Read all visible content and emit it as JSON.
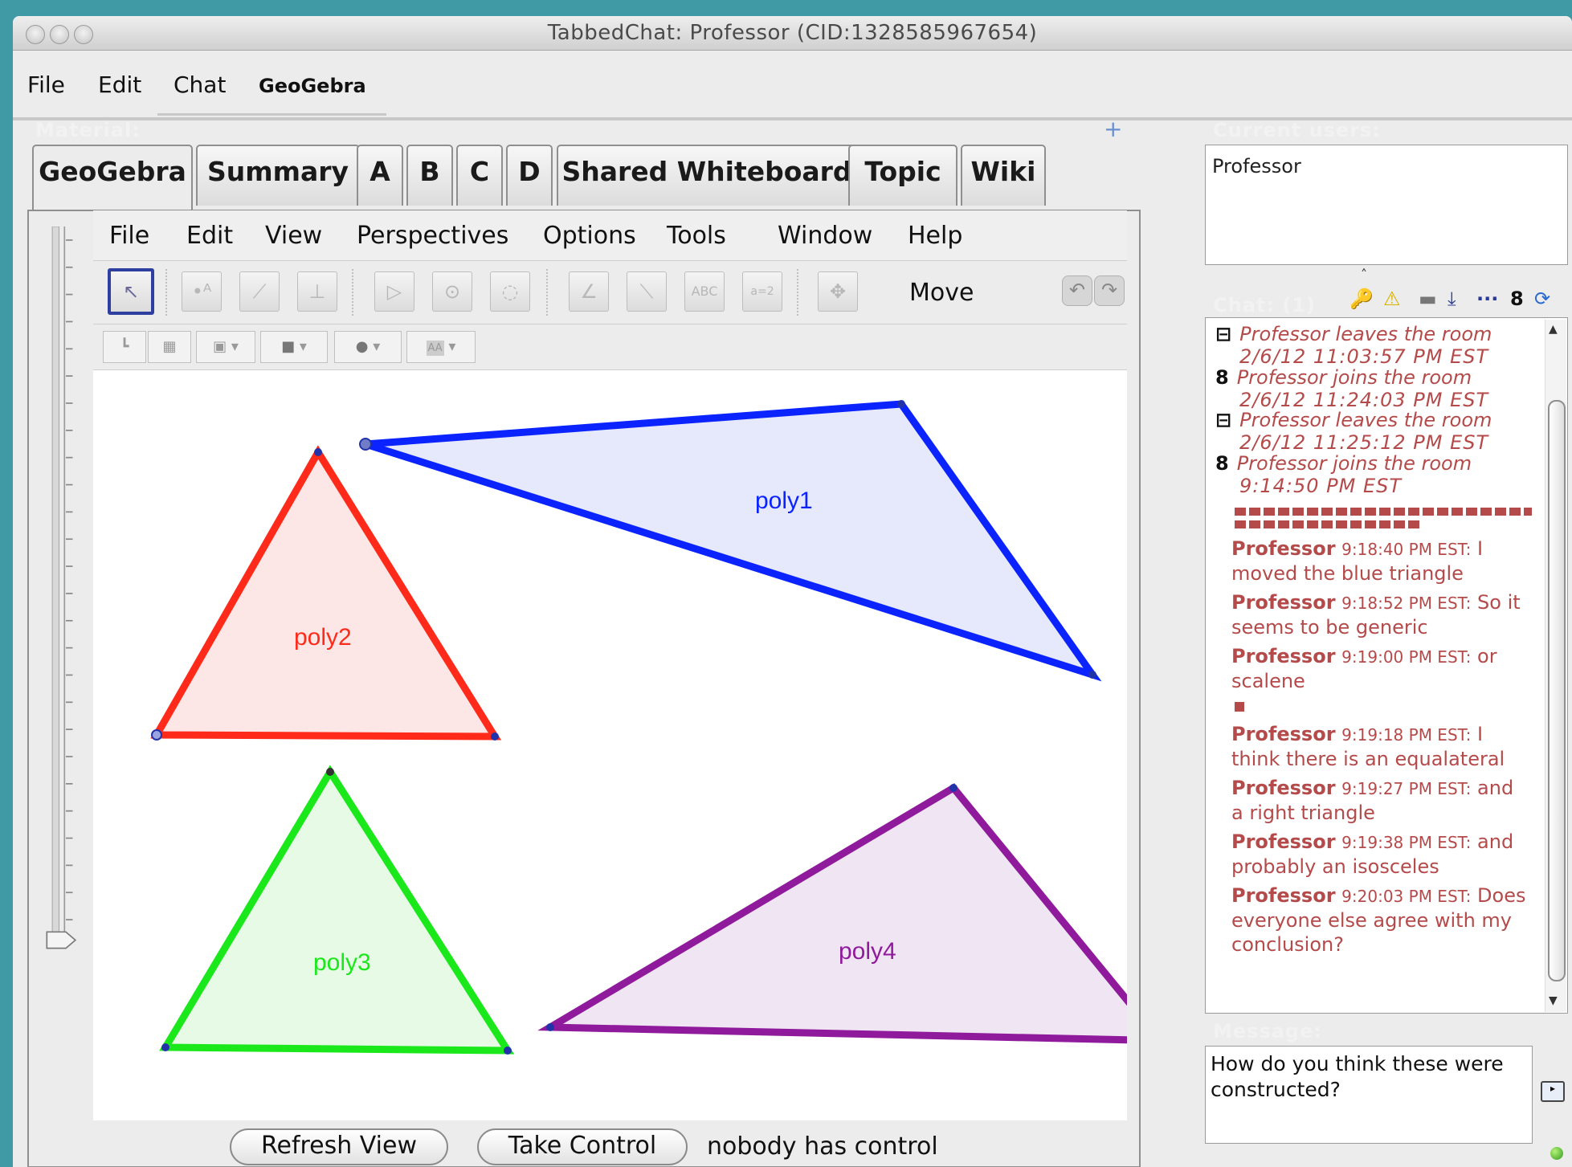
{
  "window": {
    "title": "TabbedChat: Professor (CID:1328585967654)"
  },
  "menubar": {
    "items": [
      "File",
      "Edit",
      "Chat",
      "GeoGebra"
    ]
  },
  "material": {
    "label": "Material:",
    "add_label": "+",
    "tabs": [
      "GeoGebra",
      "Summary",
      "A",
      "B",
      "C",
      "D",
      "Shared Whiteboard",
      "Topic",
      "Wiki"
    ],
    "active_tab": "GeoGebra"
  },
  "geogebra": {
    "menu": [
      "File",
      "Edit",
      "View",
      "Perspectives",
      "Options",
      "Tools",
      "Window",
      "Help"
    ],
    "toolbar": {
      "current_tool": "Move",
      "tools": [
        "move-tool-icon",
        "point-tool-icon",
        "line-tool-icon",
        "perpendicular-tool-icon",
        "polygon-tool-icon",
        "circle-tool-icon",
        "conic-tool-icon",
        "angle-tool-icon",
        "reflect-tool-icon",
        "text-tool-icon",
        "slider-tool-icon",
        "move-view-icon"
      ],
      "slider_tool_text": "a=2",
      "text_tool_text": "ABC"
    },
    "style_bar": {
      "buttons": [
        "axes-toggle-icon",
        "grid-toggle-icon",
        "color-dropdown-icon",
        "fill-dropdown-icon",
        "point-style-dropdown-icon",
        "label-style-dropdown-icon"
      ],
      "label_style_text": "AA"
    },
    "polygons": [
      {
        "name": "poly1",
        "color": "#0a23ff",
        "fill": "#e6e8fb"
      },
      {
        "name": "poly2",
        "color": "#ff2a1a",
        "fill": "#fde6e6"
      },
      {
        "name": "poly3",
        "color": "#1be81b",
        "fill": "#e6fae6"
      },
      {
        "name": "poly4",
        "color": "#8f1b9c",
        "fill": "#f0e6f3"
      }
    ]
  },
  "controls": {
    "refresh_label": "Refresh View",
    "take_control_label": "Take Control",
    "status": "nobody has control"
  },
  "current_users": {
    "label": "Current users:",
    "users": [
      "Professor"
    ]
  },
  "chat": {
    "label": "Chat: (1)",
    "toolbar_icons": [
      "search-icon",
      "alert-icon",
      "folder-icon",
      "download-icon",
      "more-icon",
      "user-icon",
      "refresh-icon"
    ],
    "events": [
      {
        "icon": "⊟",
        "text": "Professor leaves the room",
        "time": "2/6/12 11:03:57 PM EST"
      },
      {
        "icon": "8",
        "text": "Professor joins the room",
        "time": "2/6/12 11:24:03 PM EST"
      },
      {
        "icon": "⊟",
        "text": "Professor leaves the room",
        "time": "2/6/12 11:25:12 PM EST"
      },
      {
        "icon": "8",
        "text": "Professor joins the room",
        "time": "9:14:50 PM EST"
      }
    ],
    "messages": [
      {
        "author": "Professor",
        "time": "9:18:40 PM EST:",
        "lead": " I",
        "rest": "moved the blue triangle"
      },
      {
        "author": "Professor",
        "time": "9:18:52 PM EST:",
        "lead": " So it",
        "rest": "seems to be generic"
      },
      {
        "author": "Professor",
        "time": "9:19:00 PM EST:",
        "lead": " or",
        "rest": "scalene"
      },
      {
        "author": "Professor",
        "time": "9:19:18 PM EST:",
        "lead": " I",
        "rest": "think there is an equalateral"
      },
      {
        "author": "Professor",
        "time": "9:19:27 PM EST:",
        "lead": " and",
        "rest": "a right triangle"
      },
      {
        "author": "Professor",
        "time": "9:19:38 PM EST:",
        "lead": " and",
        "rest": "probably an isosceles"
      },
      {
        "author": "Professor",
        "time": "9:20:03 PM EST:",
        "lead": " Does",
        "rest": "everyone else agree with my conclusion?"
      }
    ]
  },
  "message": {
    "label": "Message:",
    "value": "How do you think these were constructed?"
  }
}
